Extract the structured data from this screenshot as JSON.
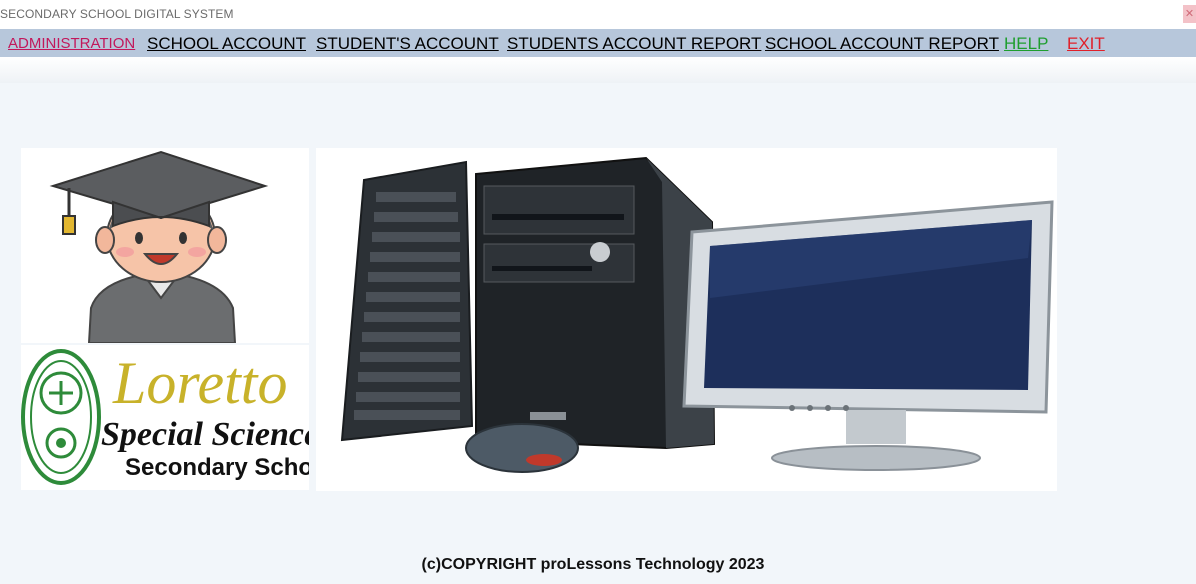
{
  "window": {
    "title": "SECONDARY SCHOOL DIGITAL SYSTEM",
    "close_label": "✕"
  },
  "menu": {
    "items": [
      {
        "label": "ADMINISTRATION",
        "color": "#c2185b"
      },
      {
        "label": "SCHOOL ACCOUNT",
        "color": "#000000"
      },
      {
        "label": "STUDENT'S ACCOUNT",
        "color": "#000000"
      },
      {
        "label": "STUDENTS ACCOUNT REPORT",
        "color": "#000000"
      },
      {
        "label": "SCHOOL ACCOUNT REPORT",
        "color": "#000000"
      },
      {
        "label": "HELP",
        "color": "#1e9e2e"
      },
      {
        "label": "EXIT",
        "color": "#e0202a"
      }
    ]
  },
  "logo": {
    "name_line1": "Loretto",
    "name_line2": "Special Science",
    "name_line3": "Secondary School"
  },
  "footer": {
    "copyright": "(c)COPYRIGHT proLessons Technology 2023"
  }
}
